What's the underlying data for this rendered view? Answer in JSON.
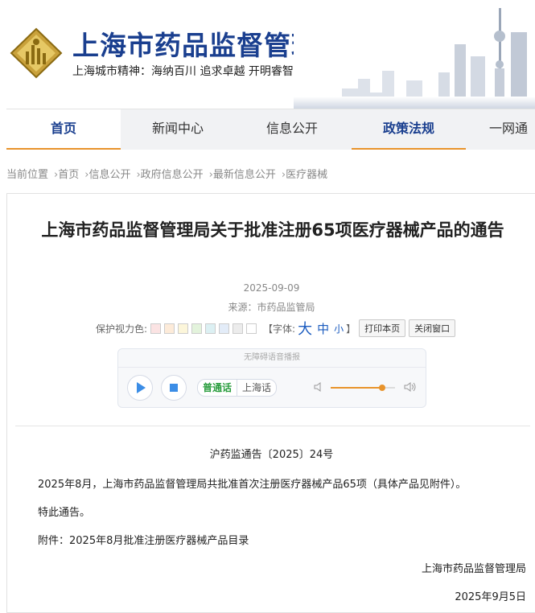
{
  "header": {
    "title": "上海市药品监督管理局",
    "slogan": "上海城市精神：海纳百川  追求卓越  开明睿智  大气谦和",
    "logo_icon": "emblem-logo-icon",
    "brand_color": "#1a3f8f"
  },
  "nav": {
    "items": [
      {
        "label": "首页"
      },
      {
        "label": "新闻中心"
      },
      {
        "label": "信息公开"
      },
      {
        "label": "政策法规"
      },
      {
        "label": "一网通"
      }
    ],
    "accent_color": "#e8932b"
  },
  "breadcrumb": {
    "prefix": "当前位置",
    "items": [
      "首页",
      "信息公开",
      "政府信息公开",
      "最新信息公开",
      "医疗器械"
    ]
  },
  "article": {
    "title": "上海市药品监督管理局关于批准注册65项医疗器械产品的通告",
    "date": "2025-09-09",
    "source": "来源：市药品监管局",
    "tools": {
      "eye_label": "保护视力色:",
      "font_label": "【字体:",
      "font_big": "大",
      "font_mid": "中",
      "font_small": "小",
      "font_end": "】",
      "print_label": "打印本页",
      "close_label": "关闭窗口",
      "swatch_colors": [
        "#fbe3e3",
        "#fdebd9",
        "#fcf6da",
        "#e3f3dc",
        "#dcf0f3",
        "#e3ecf8",
        "#ececec",
        "#ffffff"
      ]
    },
    "player": {
      "header": "无障碍语音播报",
      "lang_mandarin": "普通话",
      "lang_shanghai": "上海话",
      "volume_percent": 80
    },
    "doc_number": "沪药监通告〔2025〕24号",
    "paragraphs": [
      "2025年8月，上海市药品监督管理局共批准首次注册医疗器械产品65项（具体产品见附件）。",
      "特此通告。",
      "附件：2025年8月批准注册医疗器械产品目录"
    ],
    "signature": "上海市药品监督管理局",
    "sign_date": "2025年9月5日"
  }
}
